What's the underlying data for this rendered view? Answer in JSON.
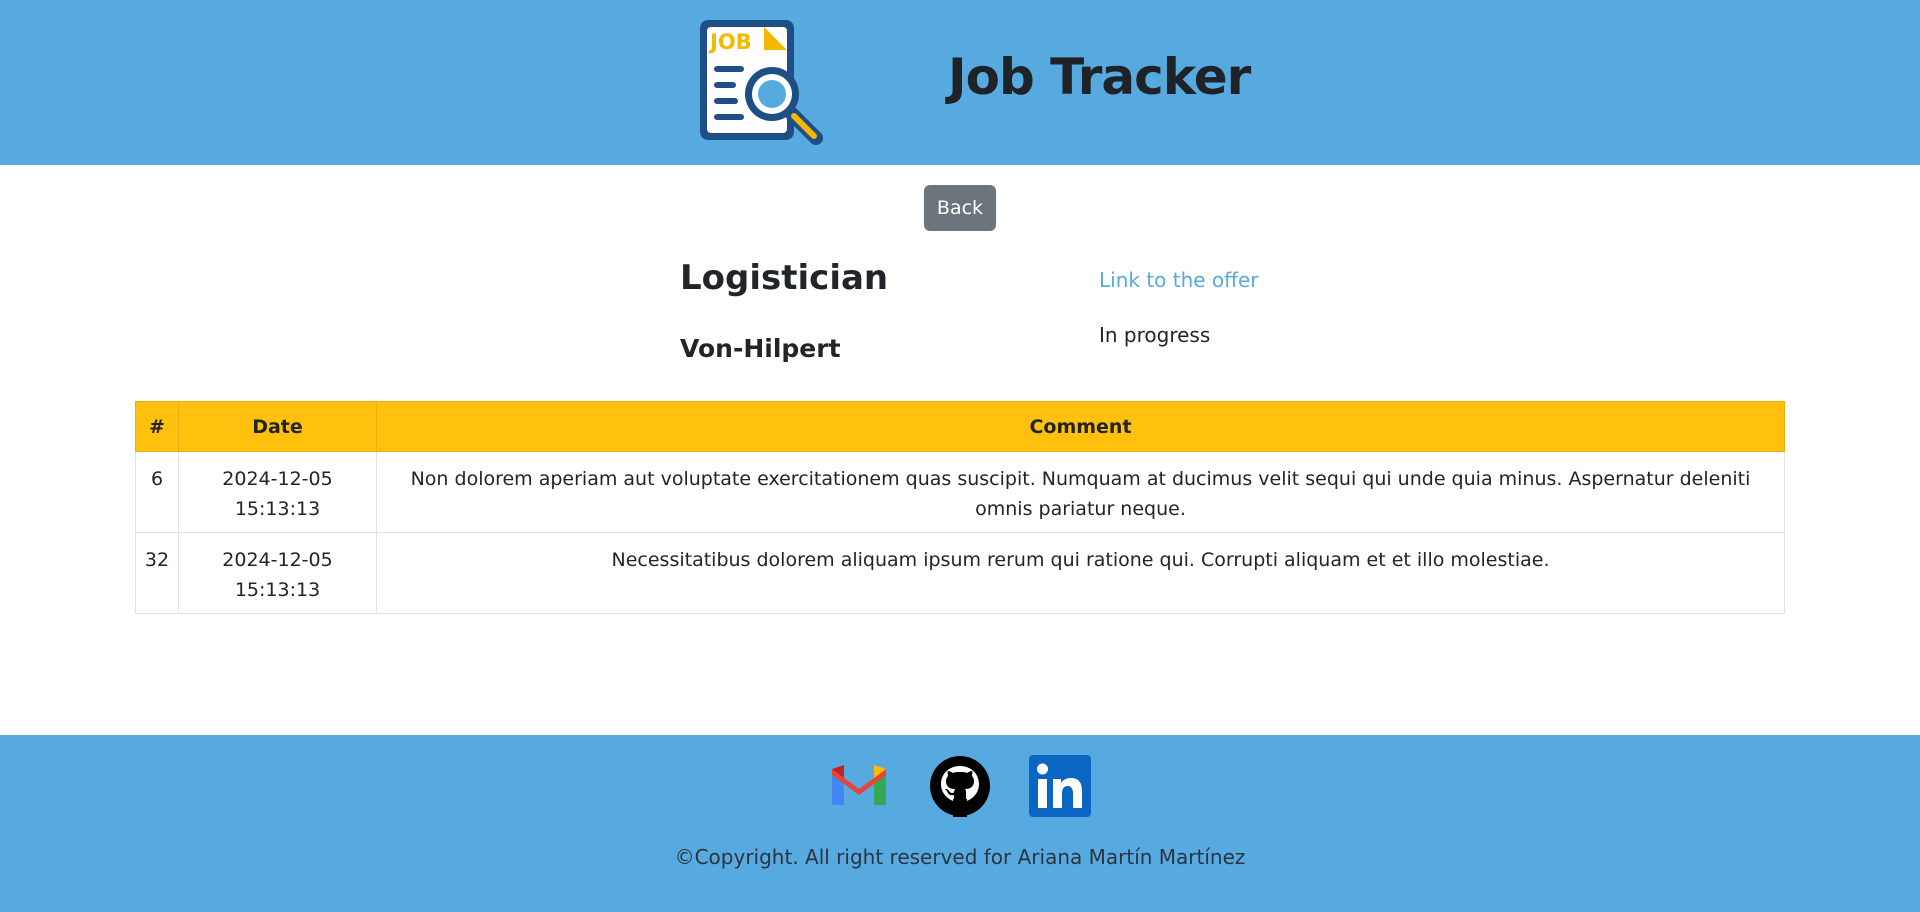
{
  "header": {
    "logo_text": "JOB",
    "title": "Job Tracker"
  },
  "actions": {
    "back_label": "Back"
  },
  "job": {
    "title": "Logistician",
    "company": "Von-Hilpert",
    "offer_link_label": "Link to the offer",
    "status": "In progress"
  },
  "table": {
    "columns": [
      "#",
      "Date",
      "Comment"
    ],
    "rows": [
      {
        "id": "6",
        "date": "2024-12-05",
        "time": "15:13:13",
        "comment": "Non dolorem aperiam aut voluptate exercitationem quas suscipit. Numquam at ducimus velit sequi qui unde quia minus. Aspernatur deleniti omnis pariatur neque."
      },
      {
        "id": "32",
        "date": "2024-12-05",
        "time": "15:13:13",
        "comment": "Necessitatibus dolorem aliquam ipsum rerum qui ratione qui. Corrupti aliquam et et illo molestiae."
      }
    ]
  },
  "footer": {
    "icons": [
      "gmail-icon",
      "github-icon",
      "linkedin-icon"
    ],
    "copyright": "©Copyright. All right reserved for Ariana Martín Martínez"
  },
  "colors": {
    "header_bg": "#56aae0",
    "table_header_bg": "#ffc10e",
    "back_button": "#6c757d",
    "link": "#56aae0"
  }
}
